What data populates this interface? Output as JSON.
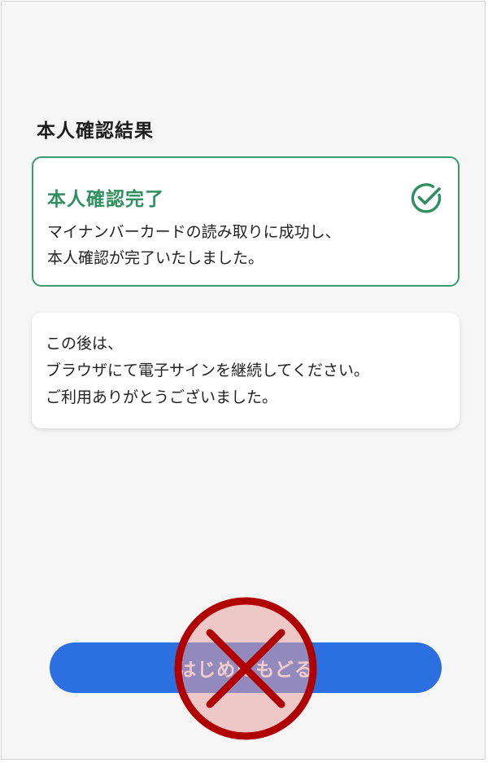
{
  "page": {
    "title": "本人確認結果"
  },
  "result_card": {
    "heading": "本人確認完了",
    "message_lines": [
      "マイナンバーカードの読み取りに成功し、",
      "本人確認が完了いたしました。"
    ],
    "icon": "check-circle-icon",
    "accent_color": "#2f8f5e"
  },
  "info_card": {
    "message_lines": [
      "この後は、",
      "ブラウザにて電子サインを継続してください。",
      "ご利用ありがとうございました。"
    ]
  },
  "back_button": {
    "label": "はじめにもどる",
    "color": "#2c6fe0"
  },
  "overlay": {
    "icon": "prohibited-x-icon",
    "color": "#b00000"
  }
}
